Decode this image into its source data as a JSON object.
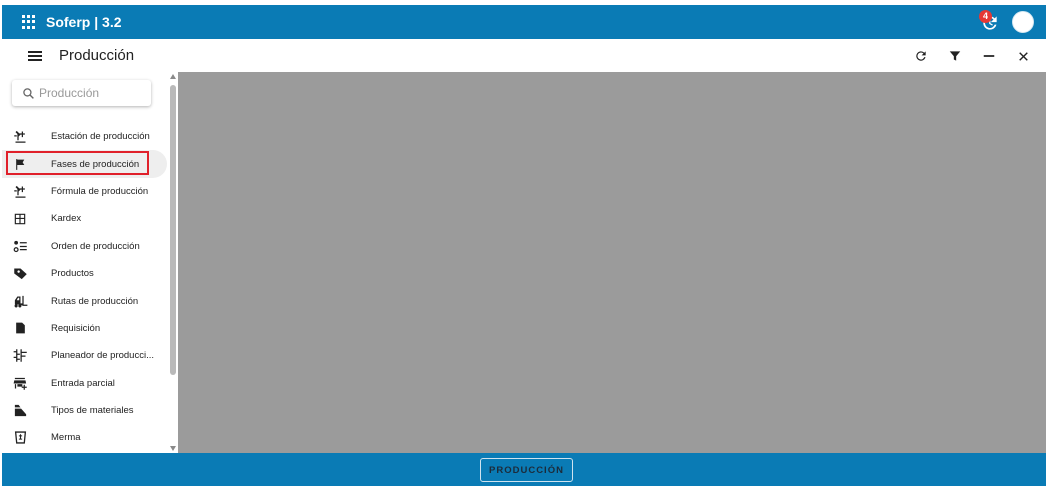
{
  "app": {
    "title": "Soferp | 3.2",
    "notification_count": "4"
  },
  "header": {
    "title": "Producción"
  },
  "search": {
    "placeholder": "Producción"
  },
  "sidebar": {
    "items": [
      {
        "label": "Estación de producción",
        "icon": "production-station-icon"
      },
      {
        "label": "Fases de producción",
        "icon": "flag-icon",
        "active": true
      },
      {
        "label": "Fórmula de producción",
        "icon": "production-formula-icon"
      },
      {
        "label": "Kardex",
        "icon": "table-icon"
      },
      {
        "label": "Orden de producción",
        "icon": "list-order-icon"
      },
      {
        "label": "Productos",
        "icon": "tag-icon"
      },
      {
        "label": "Rutas de producción",
        "icon": "forklift-icon"
      },
      {
        "label": "Requisición",
        "icon": "document-icon"
      },
      {
        "label": "Planeador de producci...",
        "icon": "planner-icon"
      },
      {
        "label": "Entrada parcial",
        "icon": "store-add-icon"
      },
      {
        "label": "Tipos de materiales",
        "icon": "materials-icon"
      },
      {
        "label": "Merma",
        "icon": "waste-icon"
      }
    ]
  },
  "footer": {
    "button_label": "PRODUCCIÓN"
  },
  "colors": {
    "primary": "#0a7bb5",
    "content_bg": "#9b9b9b",
    "highlight": "#e0202a",
    "badge": "#e53935"
  }
}
